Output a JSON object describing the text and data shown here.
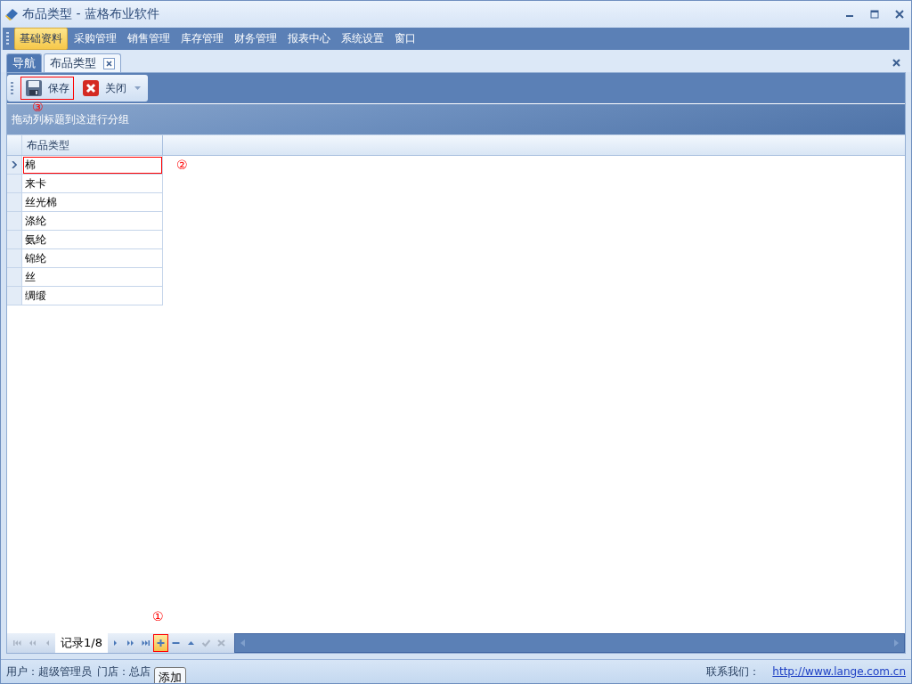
{
  "window": {
    "title": "布品类型 - 蓝格布业软件"
  },
  "menu": [
    {
      "label": "基础资料",
      "selected": true
    },
    {
      "label": "采购管理",
      "selected": false
    },
    {
      "label": "销售管理",
      "selected": false
    },
    {
      "label": "库存管理",
      "selected": false
    },
    {
      "label": "财务管理",
      "selected": false
    },
    {
      "label": "报表中心",
      "selected": false
    },
    {
      "label": "系统设置",
      "selected": false
    },
    {
      "label": "窗口",
      "selected": false
    }
  ],
  "tabs": [
    {
      "label": "导航",
      "selected": false,
      "closable": false
    },
    {
      "label": "布品类型",
      "selected": true,
      "closable": true
    }
  ],
  "toolbar": [
    {
      "label": "保存",
      "kind": "save",
      "annotation": "③"
    },
    {
      "label": "关闭",
      "kind": "close"
    }
  ],
  "group_panel": {
    "hint": "拖动列标题到这进行分组"
  },
  "grid": {
    "columns": [
      "布品类型"
    ],
    "annotation": "②",
    "rows": [
      {
        "cells": [
          "棉"
        ],
        "selected": true
      },
      {
        "cells": [
          "来卡"
        ],
        "selected": false
      },
      {
        "cells": [
          "丝光棉"
        ],
        "selected": false
      },
      {
        "cells": [
          "涤纶"
        ],
        "selected": false
      },
      {
        "cells": [
          "氨纶"
        ],
        "selected": false
      },
      {
        "cells": [
          "锦纶"
        ],
        "selected": false
      },
      {
        "cells": [
          "丝"
        ],
        "selected": false
      },
      {
        "cells": [
          "绸缎"
        ],
        "selected": false
      }
    ]
  },
  "navigator": {
    "record": "记录1/8",
    "buttons": [
      {
        "kind": "first",
        "disabled": true
      },
      {
        "kind": "prev-page",
        "disabled": true
      },
      {
        "kind": "prev",
        "disabled": true
      },
      {
        "kind": "record"
      },
      {
        "kind": "next",
        "disabled": false
      },
      {
        "kind": "next-page",
        "disabled": false
      },
      {
        "kind": "last",
        "disabled": false
      },
      {
        "kind": "add",
        "disabled": false,
        "annotation": "①"
      },
      {
        "kind": "remove",
        "disabled": false
      },
      {
        "kind": "edit",
        "disabled": false
      },
      {
        "kind": "end-edit",
        "disabled": true
      },
      {
        "kind": "cancel",
        "disabled": true
      }
    ],
    "tooltip": "添加"
  },
  "status_bar": {
    "user": "用户：超级管理员",
    "store": "门店：总店",
    "contact": "联系我们：",
    "link": "http://www.lange.com.cn"
  }
}
